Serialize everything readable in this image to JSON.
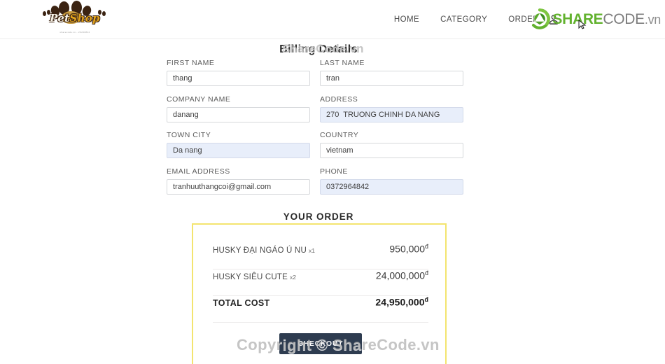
{
  "header": {
    "logo": {
      "pet": "Pet",
      "shop": "Shop",
      "subtitle": "sharecode.vn - 20230822"
    },
    "nav": [
      {
        "label": "HOME",
        "name": "nav-home"
      },
      {
        "label": "CATEGORY",
        "name": "nav-category"
      },
      {
        "label": "ORDER",
        "name": "nav-order"
      }
    ],
    "account_icon": "user-account-icon",
    "brand": {
      "share": "SHARE",
      "code": "CODE",
      "vn": ".vn",
      "glyph": "sharecode-recycle-logo-icon"
    }
  },
  "checkout": {
    "title": "Billing Details",
    "fields": [
      {
        "label": "FIRST NAME",
        "value": "thang",
        "name": "first-name",
        "autofilled": false
      },
      {
        "label": "LAST NAME",
        "value": "tran",
        "name": "last-name",
        "autofilled": false
      },
      {
        "label": "COMPANY NAME",
        "value": "danang",
        "name": "company-name",
        "autofilled": false
      },
      {
        "label": "ADDRESS",
        "value": "270  TRUONG CHINH DA NANG",
        "name": "address",
        "autofilled": true
      },
      {
        "label": "TOWN CITY",
        "value": "Da nang",
        "name": "town-city",
        "autofilled": true
      },
      {
        "label": "COUNTRY",
        "value": "vietnam",
        "name": "country",
        "autofilled": false
      },
      {
        "label": "EMAIL ADDRESS",
        "value": "tranhuuthangcoi@gmail.com",
        "name": "email-address",
        "autofilled": false
      },
      {
        "label": "PHONE",
        "value": "0372964842",
        "name": "phone",
        "autofilled": true
      }
    ]
  },
  "order": {
    "heading": "YOUR ORDER",
    "items": [
      {
        "name": "HUSKY ĐẠI NGÁO Ú NU",
        "qty": "x1",
        "price": "950,000",
        "currency": "đ"
      },
      {
        "name": "HUSKY SIÊU CUTE",
        "qty": "x2",
        "price": "24,000,000",
        "currency": "đ"
      }
    ],
    "total_label": "TOTAL COST",
    "total_price": "24,950,000",
    "total_currency": "đ",
    "checkout_label": "CHECKOUT",
    "accent_border": "#f3e46f",
    "button_color": "#2e3c50"
  },
  "watermarks": {
    "top": "ShareCode.vn",
    "bottom": "Copyright © ShareCode.vn"
  }
}
